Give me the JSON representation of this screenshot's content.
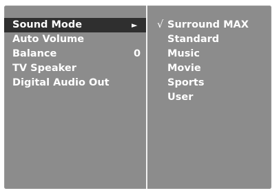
{
  "menu": {
    "items": [
      {
        "label": "Sound Mode",
        "arrow": "►",
        "value": "",
        "selected": true
      },
      {
        "label": "Auto Volume",
        "arrow": "",
        "value": "",
        "selected": false
      },
      {
        "label": "Balance",
        "arrow": "",
        "value": "0",
        "selected": false
      },
      {
        "label": "TV Speaker",
        "arrow": "",
        "value": "",
        "selected": false
      },
      {
        "label": "Digital Audio Out",
        "arrow": "",
        "value": "",
        "selected": false
      }
    ]
  },
  "submenu": {
    "check_symbol": "√",
    "options": [
      {
        "label": "Surround MAX",
        "checked": true
      },
      {
        "label": "Standard",
        "checked": false
      },
      {
        "label": "Music",
        "checked": false
      },
      {
        "label": "Movie",
        "checked": false
      },
      {
        "label": "Sports",
        "checked": false
      },
      {
        "label": "User",
        "checked": false
      }
    ]
  },
  "colors": {
    "panel_background": "#8c8c8c",
    "highlight_background": "#2f2f2f",
    "text": "#ffffff",
    "divider": "#f2f2f2"
  }
}
